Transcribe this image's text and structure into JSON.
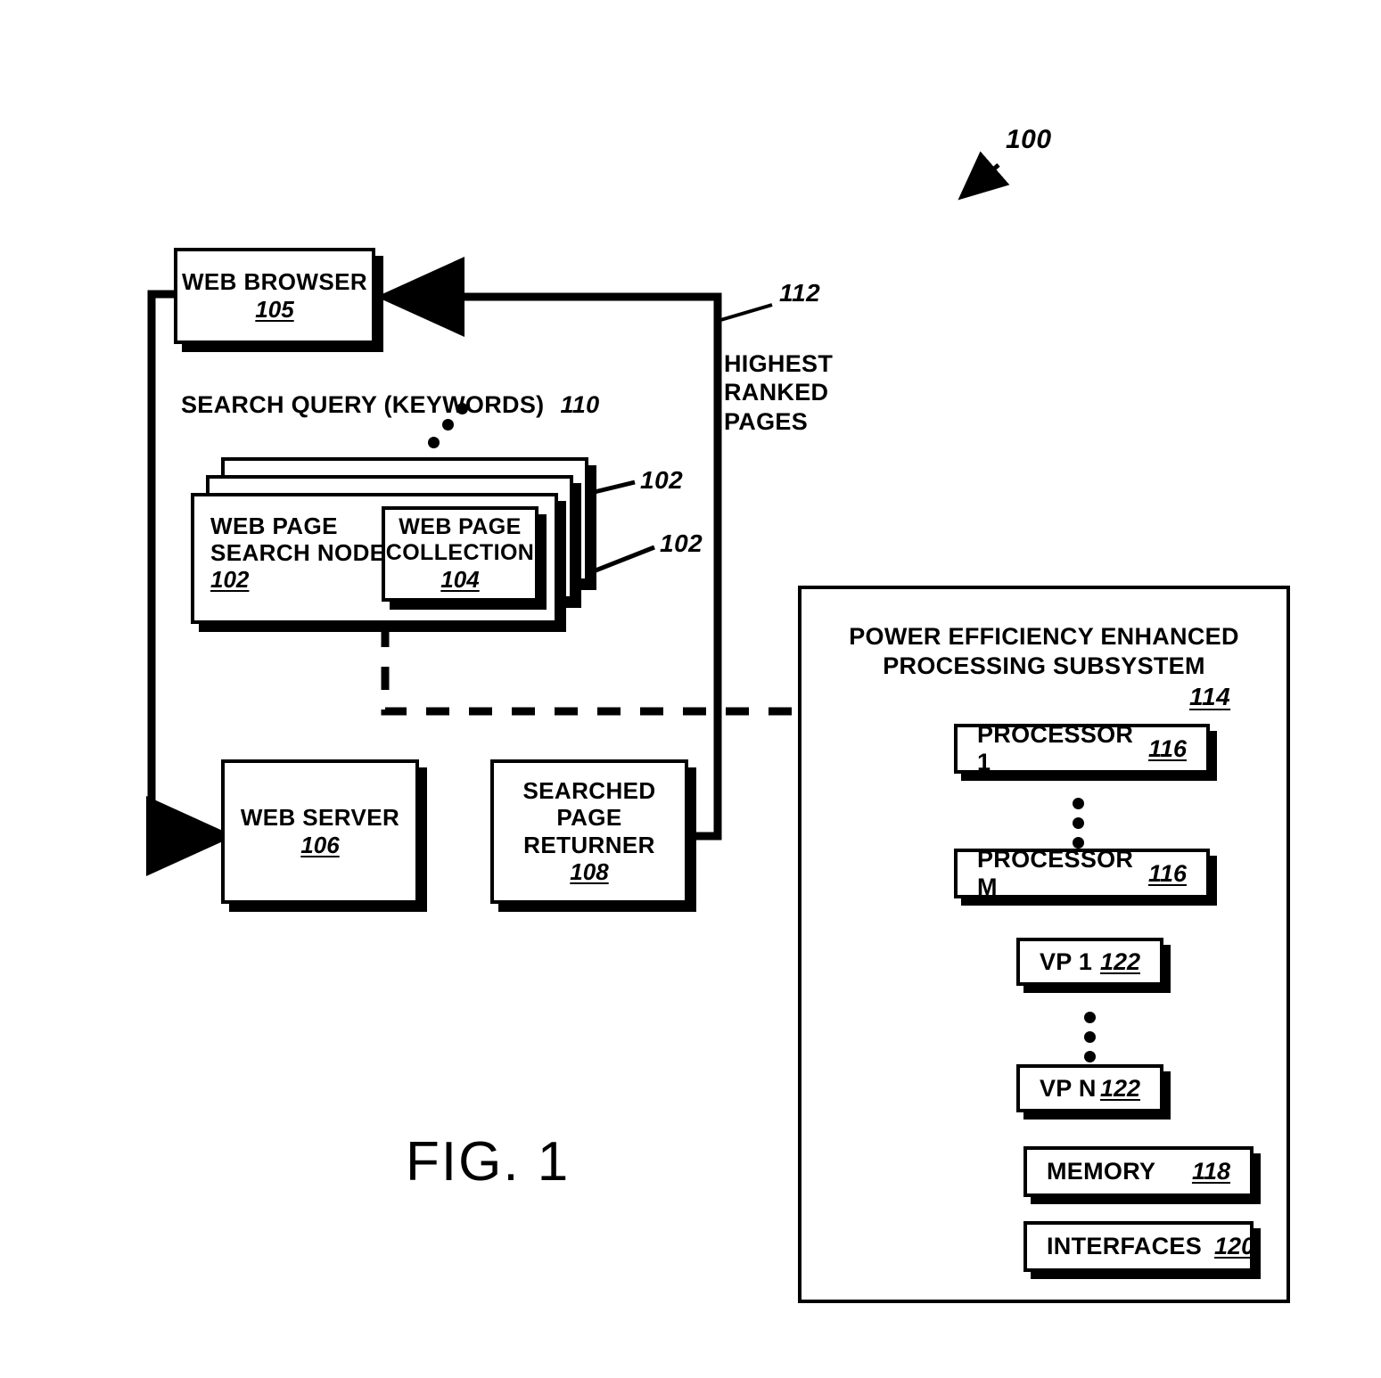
{
  "figure": {
    "caption": "FIG. 1",
    "system_ref": "100"
  },
  "left": {
    "web_browser": {
      "label": "WEB BROWSER",
      "ref": "105"
    },
    "search_query": {
      "label": "SEARCH QUERY (KEYWORDS)",
      "ref": "110"
    },
    "web_page_search_node": {
      "label": "WEB PAGE\nSEARCH NODE",
      "ref": "102"
    },
    "web_page_collection": {
      "label": "WEB PAGE\nCOLLECTION",
      "ref": "104"
    },
    "stack_ref_upper": "102",
    "stack_ref_lower": "102",
    "web_server": {
      "label": "WEB SERVER",
      "ref": "106"
    },
    "searched_page_returner": {
      "label": "SEARCHED\nPAGE\nRETURNER",
      "ref": "108"
    },
    "highest_ranked_pages": {
      "label": "HIGHEST\nRANKED\nPAGES",
      "ref": "112"
    }
  },
  "subsystem": {
    "title": "POWER EFFICIENCY ENHANCED\nPROCESSING SUBSYSTEM",
    "ref": "114",
    "processors": [
      {
        "label": "PROCESSOR 1",
        "ref": "116"
      },
      {
        "label": "PROCESSOR M",
        "ref": "116"
      }
    ],
    "vps": [
      {
        "label": "VP 1",
        "ref": "122"
      },
      {
        "label": "VP N",
        "ref": "122"
      }
    ],
    "memory": {
      "label": "MEMORY",
      "ref": "118"
    },
    "interfaces": {
      "label": "INTERFACES",
      "ref": "120"
    }
  },
  "colors": {
    "ink": "#000000",
    "paper": "#ffffff"
  }
}
